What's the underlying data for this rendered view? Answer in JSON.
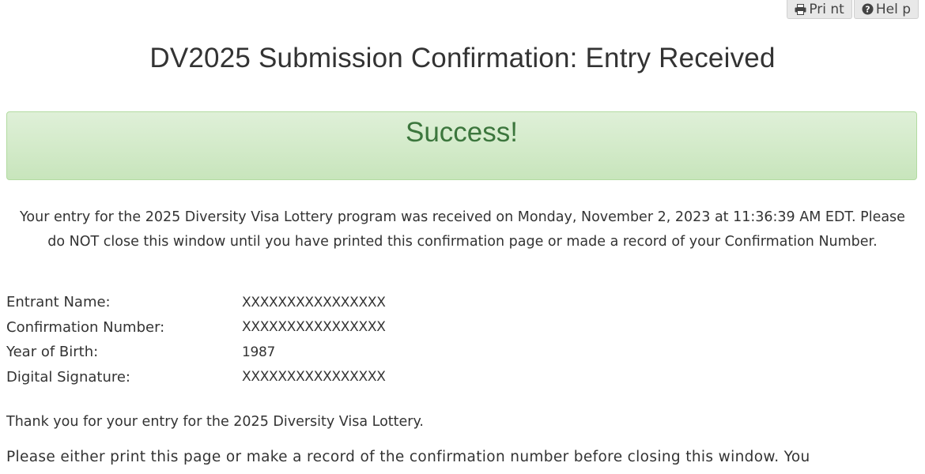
{
  "toolbar": {
    "print_label": "Pri nt",
    "help_label": "Hel p"
  },
  "page": {
    "title": "DV2025 Submission Confirmation: Entry Received"
  },
  "alert": {
    "text": "Success!",
    "color": "#3c763d",
    "background": "#dff0d8"
  },
  "notice": {
    "text": "Your entry for the 2025 Diversity Visa Lottery program was received on Monday, November 2, 2023 at 11:36:39 AM EDT. Please do NOT close this window until you have printed this confirmation page or made a record of your Confirmation Number."
  },
  "details": [
    {
      "label": "Entrant Name:",
      "value": "XXXXXXXXXXXXXXXX"
    },
    {
      "label": "Confirmation Number:",
      "value": "XXXXXXXXXXXXXXXX"
    },
    {
      "label": "Year of Birth:",
      "value": "1987"
    },
    {
      "label": "Digital Signature:",
      "value": "XXXXXXXXXXXXXXXX"
    }
  ],
  "thanks": "Thank you for your entry for the 2025 Diversity Visa Lottery.",
  "instructions": "Please either print this page or make a record of the confirmation number before closing this window. You"
}
